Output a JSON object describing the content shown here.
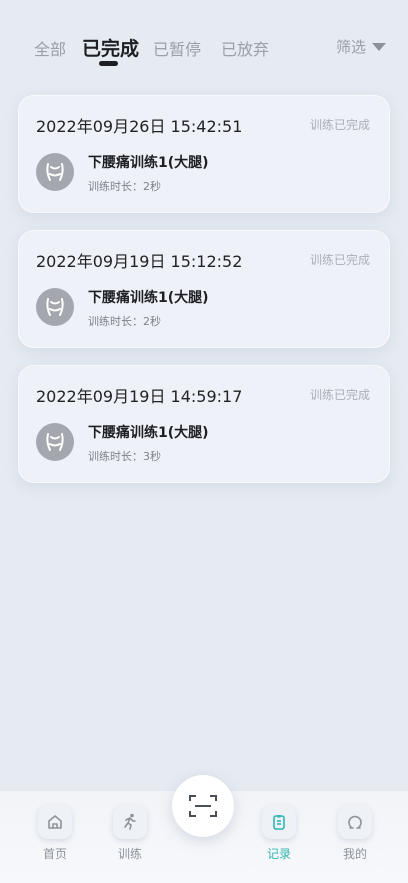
{
  "tabs": [
    {
      "label": "全部",
      "active": false
    },
    {
      "label": "已完成",
      "active": true
    },
    {
      "label": "已暂停",
      "active": false
    },
    {
      "label": "已放弃",
      "active": false
    }
  ],
  "filter": {
    "label": "筛选",
    "icon": "caret-down-icon"
  },
  "records": [
    {
      "datetime": "2022年09月26日 15:42:51",
      "status": "训练已完成",
      "name": "下腰痛训练1(大腿)",
      "duration": "训练时长：2秒"
    },
    {
      "datetime": "2022年09月19日 15:12:52",
      "status": "训练已完成",
      "name": "下腰痛训练1(大腿)",
      "duration": "训练时长：2秒"
    },
    {
      "datetime": "2022年09月19日 14:59:17",
      "status": "训练已完成",
      "name": "下腰痛训练1(大腿)",
      "duration": "训练时长：3秒"
    }
  ],
  "nav": [
    {
      "label": "首页",
      "icon": "home-icon",
      "active": false
    },
    {
      "label": "训练",
      "icon": "running-icon",
      "active": false
    },
    {
      "label": "记录",
      "icon": "clipboard-icon",
      "active": true
    },
    {
      "label": "我的",
      "icon": "user-icon",
      "active": false
    }
  ],
  "scan": {
    "icon": "scan-icon"
  },
  "colors": {
    "accent": "#32b6b2",
    "background": "#e6ebf2",
    "card": "#eef1f7"
  }
}
